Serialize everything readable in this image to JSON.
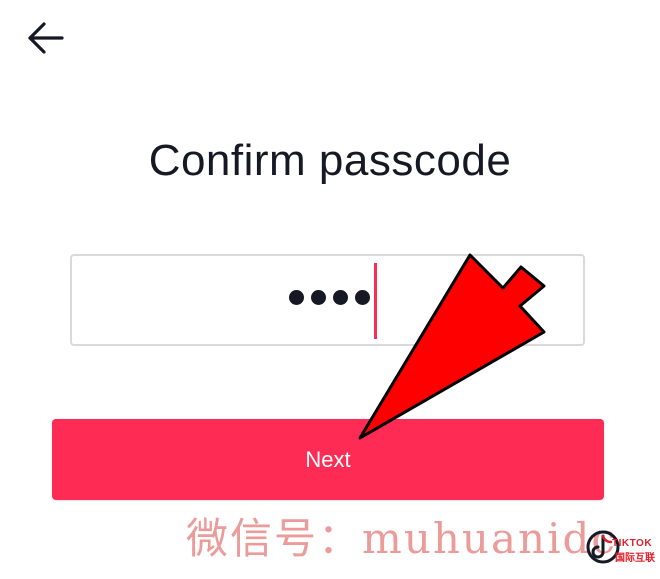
{
  "header": {
    "back_icon": "arrow-left-icon"
  },
  "title": "Confirm passcode",
  "passcode": {
    "masked_value": "••••",
    "digits_entered": 4
  },
  "next_button": {
    "label": "Next"
  },
  "annotation": {
    "type": "red-arrow-pointer",
    "color": "#ff0000"
  },
  "watermark": {
    "text": "微信号：muhuanidc"
  },
  "brand_logo": {
    "top_text": "TIKTOK",
    "bottom_text": "国际互联"
  },
  "colors": {
    "accent": "#fe2c55",
    "text": "#161823",
    "border": "#d9d9dc"
  }
}
